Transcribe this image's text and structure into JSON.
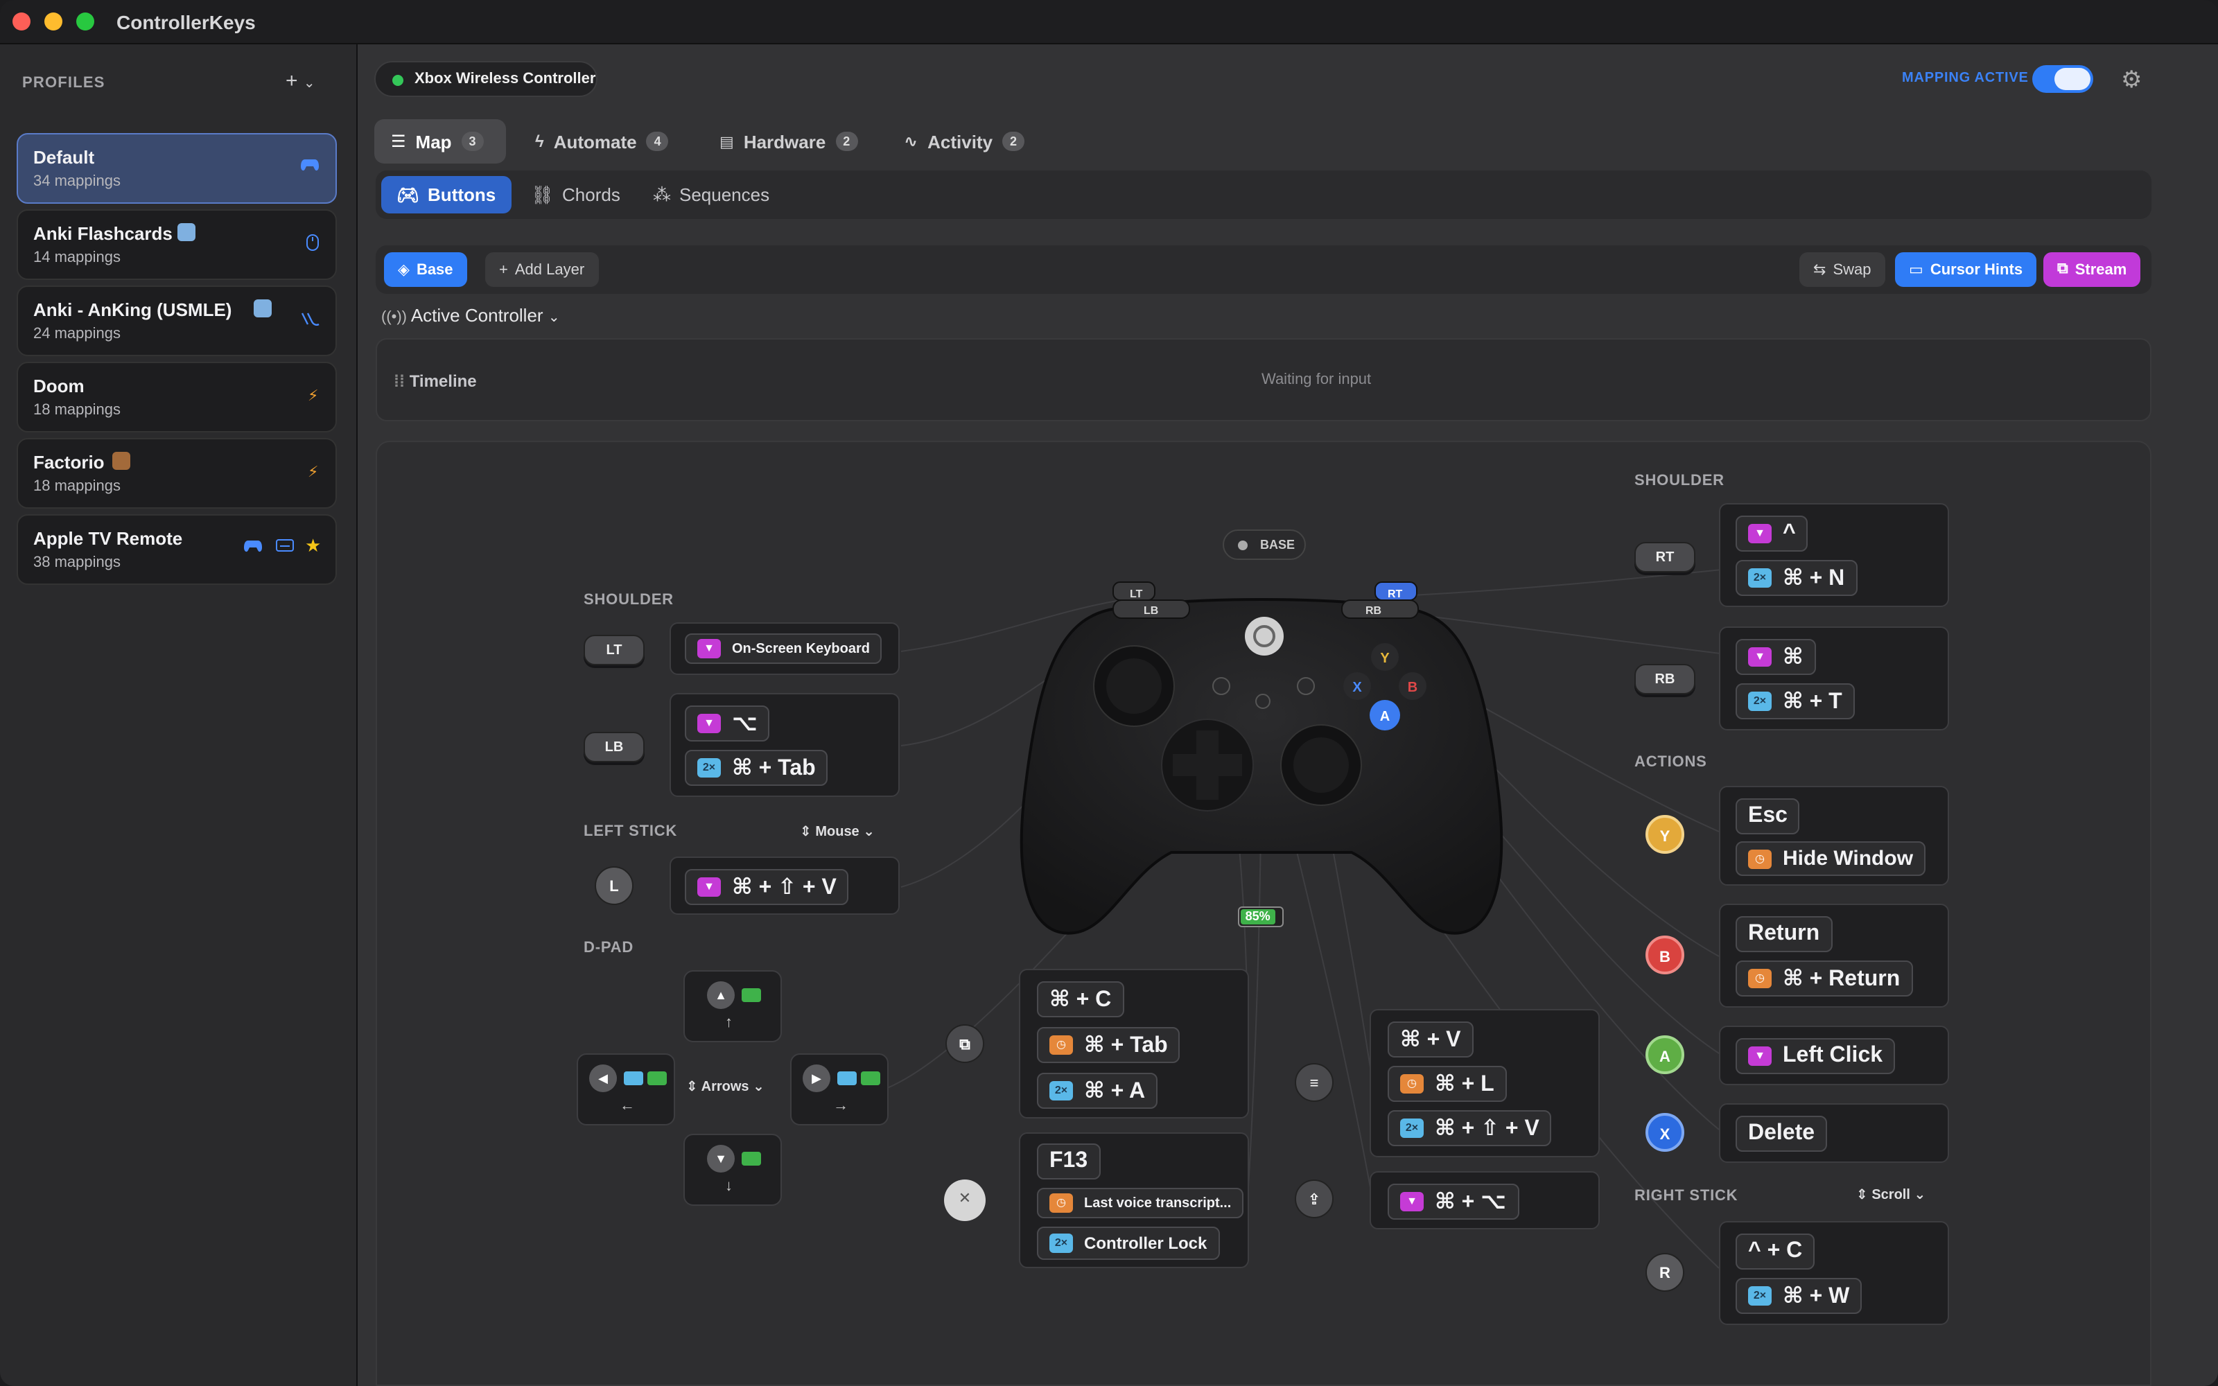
{
  "app_title": "ControllerKeys",
  "sidebar": {
    "header": "PROFILES",
    "add_label": "+",
    "profiles": [
      {
        "name": "Default",
        "count": "34 mappings",
        "icon": "gamepad-icon"
      },
      {
        "name": "Anki Flashcards",
        "count": "14 mappings",
        "icon": "mouse-icon"
      },
      {
        "name": "Anki - AnKing (USMLE)",
        "count": "24 mappings",
        "icon": "touch-icon"
      },
      {
        "name": "Doom",
        "count": "18 mappings",
        "icon": "bolt-icon"
      },
      {
        "name": "Factorio",
        "count": "18 mappings",
        "icon": "bolt-icon"
      },
      {
        "name": "Apple TV Remote",
        "count": "38 mappings",
        "icon": "star-icon"
      }
    ]
  },
  "header": {
    "controller": "Xbox Wireless Controller",
    "mapping_active": "MAPPING ACTIVE"
  },
  "tabs": [
    {
      "label": "Map",
      "count": "3"
    },
    {
      "label": "Automate",
      "count": "4"
    },
    {
      "label": "Hardware",
      "count": "2"
    },
    {
      "label": "Activity",
      "count": "2"
    }
  ],
  "subtabs": [
    "Buttons",
    "Chords",
    "Sequences"
  ],
  "layers": {
    "base": "Base",
    "add": "Add Layer",
    "swap": "Swap",
    "cursor_hints": "Cursor Hints",
    "stream": "Stream"
  },
  "active_controller": "Active Controller",
  "timeline": {
    "label": "Timeline",
    "status": "Waiting for input"
  },
  "controller": {
    "layer_badge": "BASE",
    "battery": "85%",
    "lt": "LT",
    "lb": "LB",
    "rt": "RT",
    "rb": "RB"
  },
  "left": {
    "shoulder_title": "SHOULDER",
    "lt": {
      "chip": "LT",
      "rows": [
        "On-Screen Keyboard"
      ]
    },
    "lb": {
      "chip": "LB",
      "rows": [
        "⌥",
        "⌘ + Tab"
      ]
    },
    "left_stick_title": "LEFT STICK",
    "left_stick_mode": "Mouse",
    "left_stick_rows": [
      "⌘ + ⇧ + V"
    ],
    "dpad_title": "D-PAD",
    "dpad_mode": "Arrows"
  },
  "center": {
    "view_rows": [
      "⌘ + C",
      "⌘ + Tab",
      "⌘ + A"
    ],
    "xbox_rows": [
      "F13",
      "Last voice transcript...",
      "Controller Lock"
    ],
    "menu_rows": [
      "⌘ + V",
      "⌘ + L",
      "⌘ + ⇧ + V"
    ],
    "share_rows": [
      "⌘ + ⌥"
    ]
  },
  "right": {
    "shoulder_title": "SHOULDER",
    "rt": {
      "chip": "RT",
      "rows": [
        "^",
        "⌘ + N"
      ]
    },
    "rb": {
      "chip": "RB",
      "rows": [
        "⌘",
        "⌘ + T"
      ]
    },
    "actions_title": "ACTIONS",
    "y_rows": [
      "Esc",
      "Hide Window"
    ],
    "b_rows": [
      "Return",
      "⌘ + Return"
    ],
    "a_rows": [
      "Left Click"
    ],
    "x_rows": [
      "Delete"
    ],
    "right_stick_title": "RIGHT STICK",
    "right_stick_mode": "Scroll",
    "right_stick_rows": [
      "^ + C",
      "⌘ + W"
    ]
  },
  "icon_labels": {
    "double": "2×"
  },
  "colors": {
    "accent": "#2f7cf6",
    "stream": "#c13ad9",
    "y": "#e3a93a",
    "b": "#d9433f",
    "a": "#5fae45",
    "x": "#2c6be0"
  }
}
